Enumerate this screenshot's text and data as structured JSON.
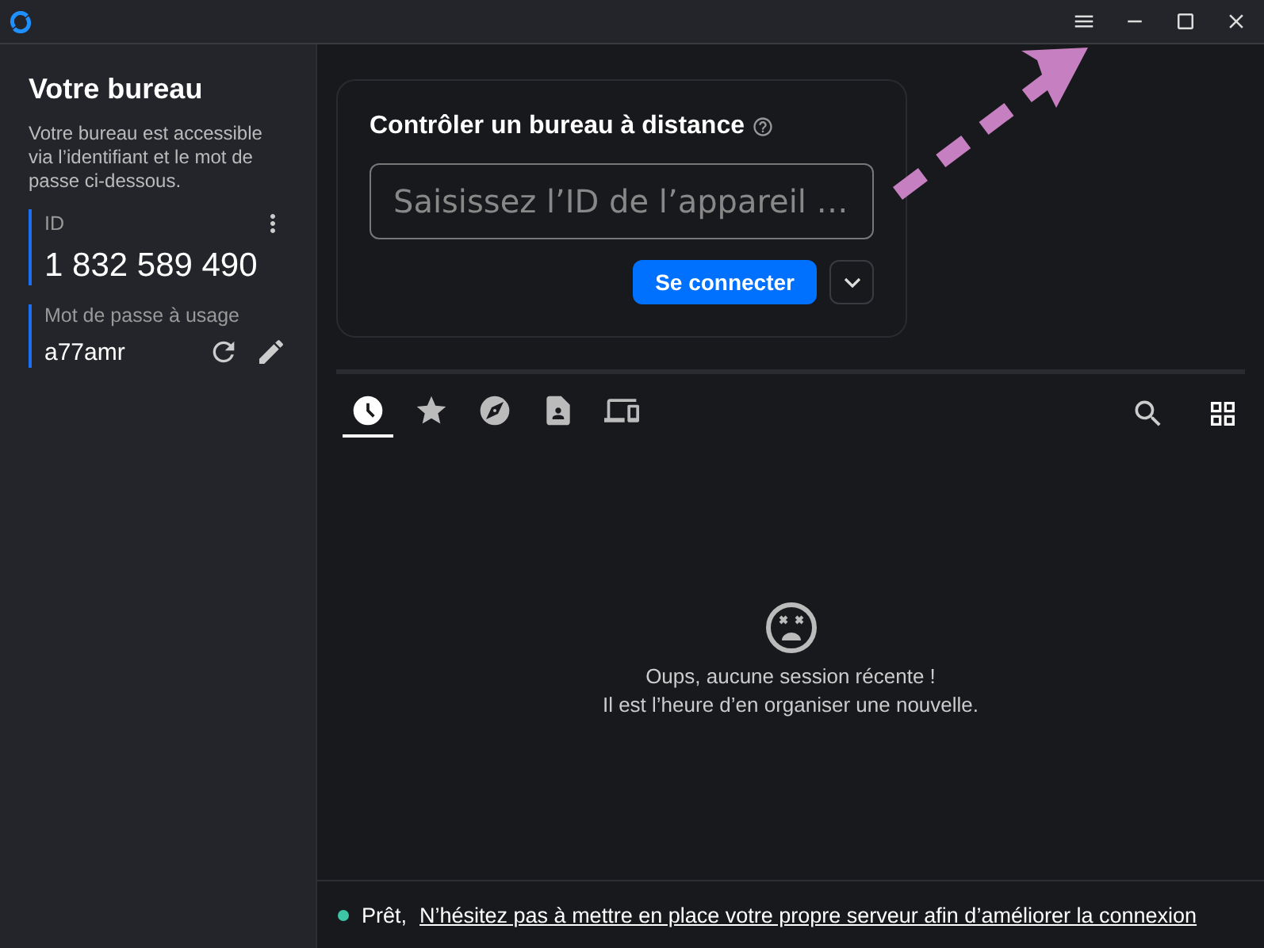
{
  "sidebar": {
    "title": "Votre bureau",
    "description": "Votre bureau est accessible via l’identifiant et le mot de passe ci-dessous.",
    "id_label": "ID",
    "id_value": "1 832 589 490",
    "password_label": "Mot de passe à usage",
    "password_value": "a77amr"
  },
  "connect": {
    "title": "Contrôler un bureau à distance",
    "placeholder": "Saisissez l’ID de l’appareil …",
    "button": "Se connecter"
  },
  "tabs": [
    {
      "kind": "recent",
      "selected": true
    },
    {
      "kind": "favorites",
      "selected": false
    },
    {
      "kind": "discovered",
      "selected": false
    },
    {
      "kind": "addressbook",
      "selected": false
    },
    {
      "kind": "group",
      "selected": false
    }
  ],
  "empty": {
    "line_1": "Oups, aucune session récente !",
    "line_2": "Il est l’heure d’en organiser une nouvelle."
  },
  "status": {
    "text": "Prêt,",
    "link": "N’hésitez pas à mettre en place votre propre serveur afin d’améliorer la connexion",
    "color": "#3cc6a6"
  }
}
